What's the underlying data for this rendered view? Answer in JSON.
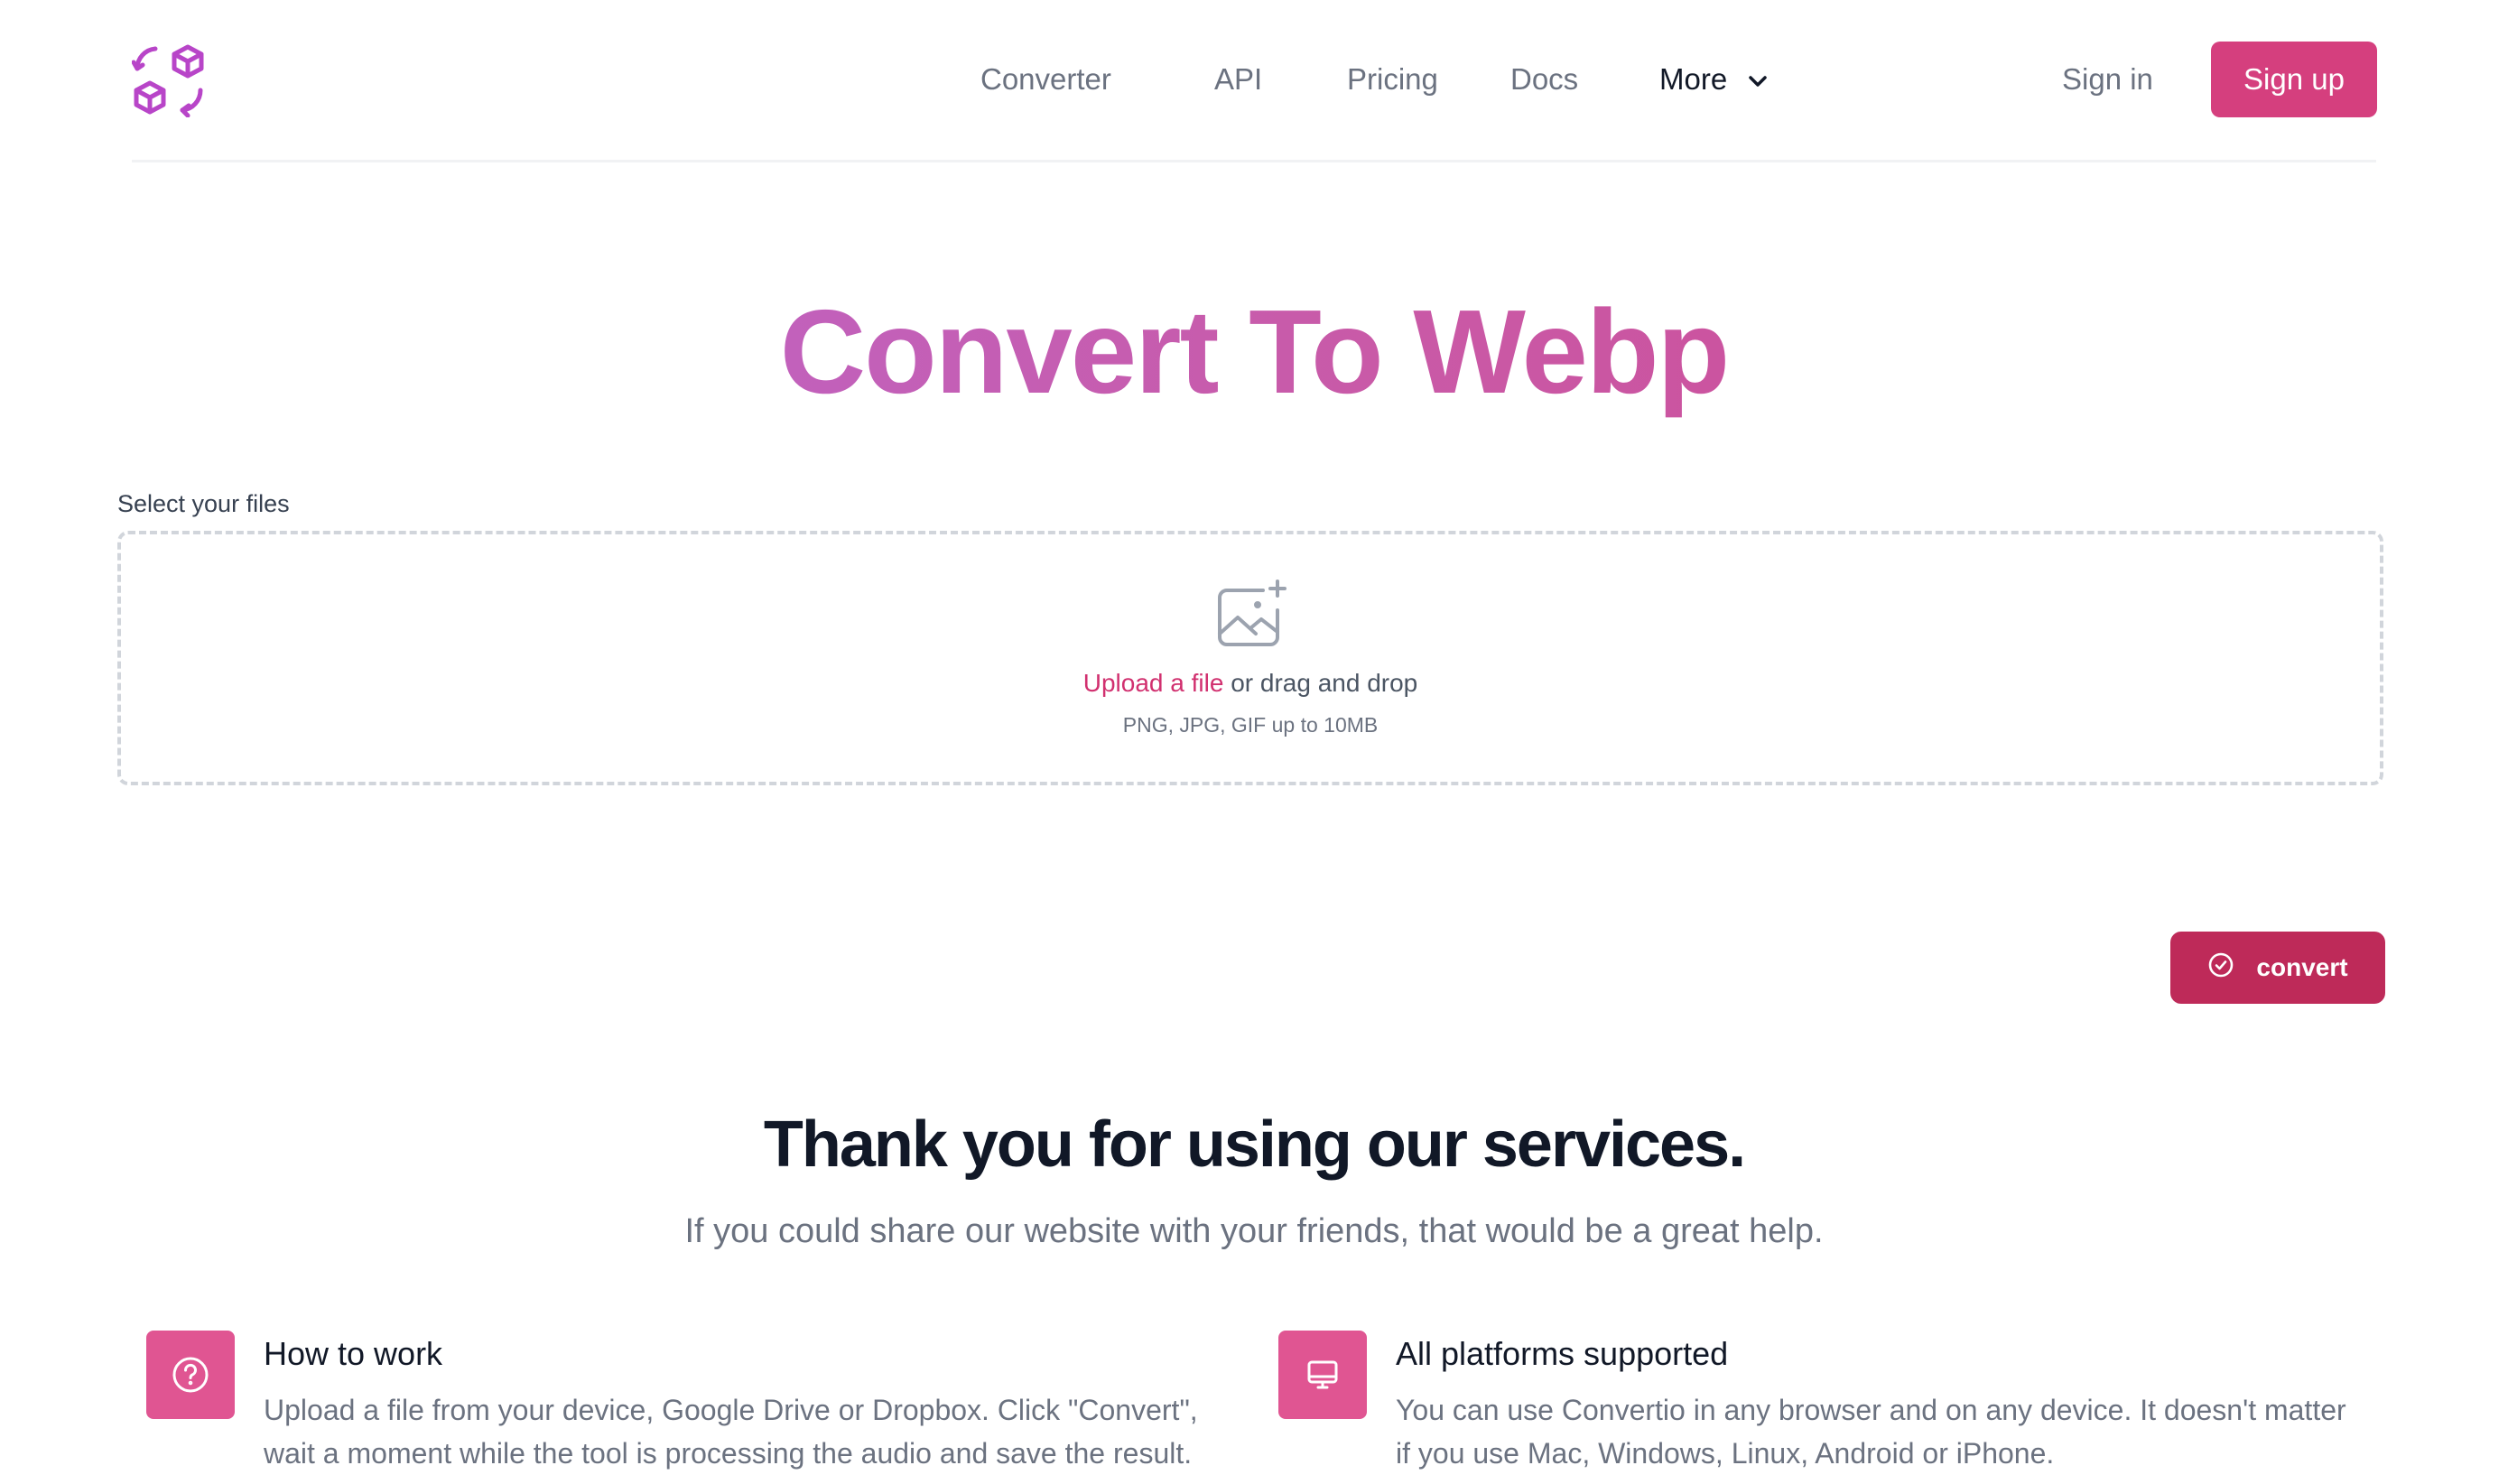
{
  "brand": {
    "accent": "#d53f7e",
    "accent_dark": "#be2a59",
    "logo_icon": "cube-exchange-logo-icon"
  },
  "nav": {
    "items": [
      {
        "label": "Converter"
      },
      {
        "label": "API"
      },
      {
        "label": "Pricing"
      },
      {
        "label": "Docs"
      }
    ],
    "more_label": "More",
    "more_icon": "chevron-down-icon",
    "signin_label": "Sign in",
    "signup_label": "Sign up"
  },
  "hero": {
    "title": "Convert To Webp"
  },
  "upload": {
    "label": "Select your files",
    "icon": "image-add-icon",
    "link_text": "Upload a file",
    "drag_text": " or drag and drop",
    "hint": "PNG, JPG, GIF up to 10MB"
  },
  "convert": {
    "label": "convert",
    "icon": "check-circle-icon"
  },
  "thanks": {
    "title": "Thank you for using our services.",
    "subtitle": "If you could share our website with your friends, that would be a great help."
  },
  "features": [
    {
      "icon": "question-circle-icon",
      "title": "How to work",
      "description": "Upload a file from your device, Google Drive or Dropbox. Click \"Convert\", wait a moment while the tool is processing the audio and save the result."
    },
    {
      "icon": "desktop-icon",
      "title": "All platforms supported",
      "description": "You can use Convertio in any browser and on any device. It doesn't matter if you use Mac, Windows, Linux, Android or iPhone."
    }
  ]
}
